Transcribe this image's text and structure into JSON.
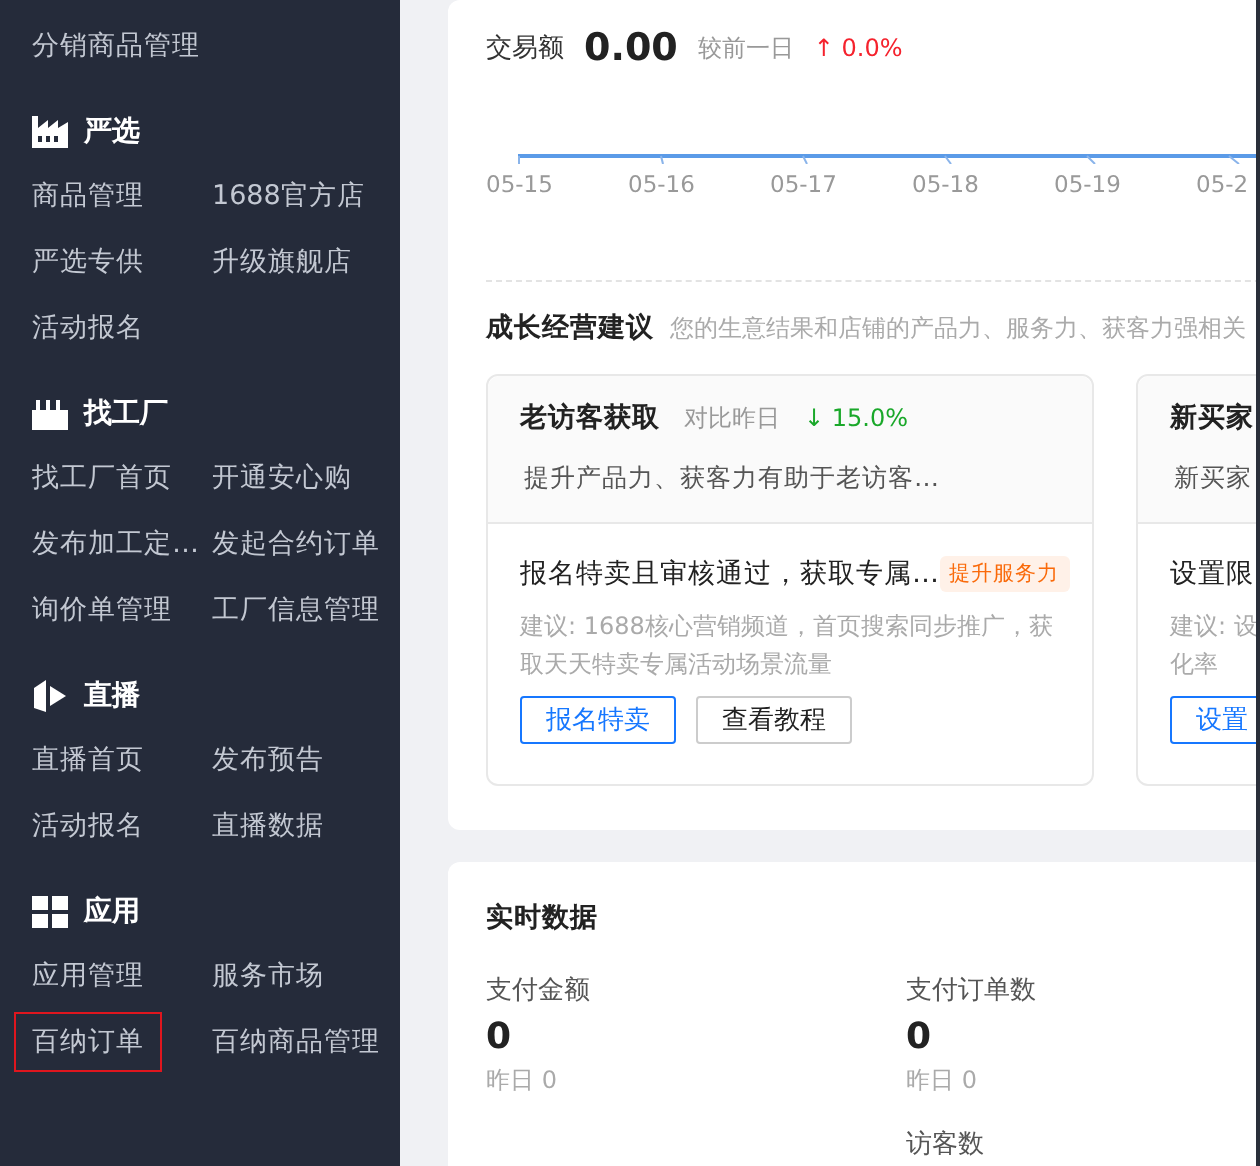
{
  "sidebar": {
    "top_items": [
      {
        "label": "分销商品管理",
        "selected": false
      }
    ],
    "sections": [
      {
        "title": "严选",
        "kind": "factory",
        "items": [
          {
            "label": "商品管理",
            "selected": false
          },
          {
            "label": "1688官方店",
            "selected": false
          },
          {
            "label": "严选专供",
            "selected": false
          },
          {
            "label": "升级旗舰店",
            "selected": false
          },
          {
            "label": "活动报名",
            "selected": false
          }
        ]
      },
      {
        "title": "找工厂",
        "kind": "chimneys",
        "items": [
          {
            "label": "找工厂首页",
            "selected": false
          },
          {
            "label": "开通安心购",
            "selected": false
          },
          {
            "label": "发布加工定…",
            "selected": false
          },
          {
            "label": "发起合约订单",
            "selected": false
          },
          {
            "label": "询价单管理",
            "selected": false
          },
          {
            "label": "工厂信息管理",
            "selected": false
          }
        ]
      },
      {
        "title": "直播",
        "kind": "live",
        "items": [
          {
            "label": "直播首页",
            "selected": false
          },
          {
            "label": "发布预告",
            "selected": false
          },
          {
            "label": "活动报名",
            "selected": false
          },
          {
            "label": "直播数据",
            "selected": false
          }
        ]
      },
      {
        "title": "应用",
        "kind": "apps",
        "items": [
          {
            "label": "应用管理",
            "selected": false
          },
          {
            "label": "服务市场",
            "selected": false
          },
          {
            "label": "百纳订单",
            "selected": true
          },
          {
            "label": "百纳商品管理",
            "selected": false
          }
        ]
      }
    ]
  },
  "overview": {
    "label": "交易额",
    "value": "0.00",
    "compare_label": "较前一日",
    "change": "↑ 0.0%",
    "kind": "rise",
    "x_axis_labels": [
      "05-15",
      "05-16",
      "05-17",
      "05-18",
      "05-19",
      "05-2"
    ]
  },
  "advice": {
    "title": "成长经营建议",
    "subtitle": "您的生意结果和店铺的产品力、服务力、获客力强相关",
    "cards": [
      {
        "title": "老访客获取",
        "compare_label": "对比昨日",
        "change": "↓ 15.0%",
        "kind": "fall",
        "desc": "提升产品力、获客力有助于老访客…",
        "task": "报名特卖且审核通过，获取专属…",
        "tag": "提升服务力",
        "advice_lines": [
          "建议: 1688核心营销频道，首页搜索同步推广，获",
          "取天天特卖专属活动场景流量"
        ],
        "buttons": [
          {
            "label": "报名特卖",
            "primary": true
          },
          {
            "label": "查看教程",
            "primary": false
          }
        ]
      },
      {
        "title": "新买家",
        "desc": "新买家",
        "task": "设置限",
        "advice_lines": [
          "建议: 设",
          "化率"
        ],
        "buttons": [
          {
            "label": "设置",
            "primary": true
          }
        ]
      }
    ]
  },
  "realtime": {
    "title": "实时数据",
    "metrics": [
      {
        "label": "支付金额",
        "value": "0",
        "yesterday": "昨日 0"
      },
      {
        "label": "支付订单数",
        "value": "0",
        "yesterday": "昨日 0"
      },
      {
        "label": "访客数"
      }
    ]
  }
}
